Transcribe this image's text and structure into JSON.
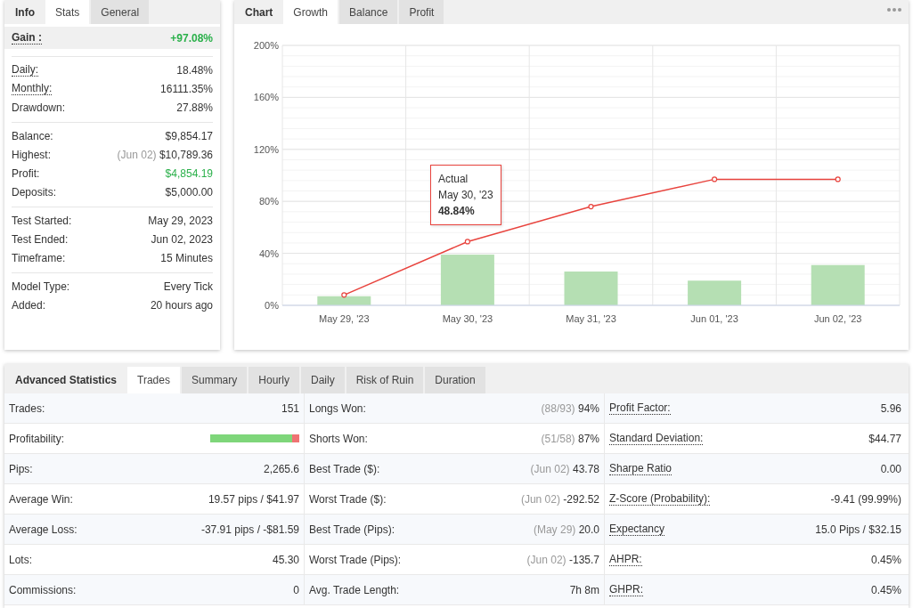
{
  "stats_panel": {
    "title": "Info",
    "tabs": [
      {
        "label": "Stats",
        "selected": true
      },
      {
        "label": "General",
        "selected": false
      }
    ],
    "gain": {
      "label": "Gain :",
      "value": "+97.08%",
      "hint": true,
      "color": "#2ab04a"
    },
    "groups": [
      [
        {
          "label": "Daily:",
          "value": "18.48%",
          "hint": true
        },
        {
          "label": "Monthly:",
          "value": "16111.35%",
          "hint": true
        },
        {
          "label": "Drawdown:",
          "value": "27.88%"
        }
      ],
      [
        {
          "label": "Balance:",
          "value": "$9,854.17"
        },
        {
          "label": "Highest:",
          "note": "(Jun 02)",
          "value": "$10,789.36"
        },
        {
          "label": "Profit:",
          "value": "$4,854.19",
          "color": "#2ab04a"
        },
        {
          "label": "Deposits:",
          "value": "$5,000.00"
        }
      ],
      [
        {
          "label": "Test Started:",
          "value": "May 29, 2023"
        },
        {
          "label": "Test Ended:",
          "value": "Jun 02, 2023"
        },
        {
          "label": "Timeframe:",
          "value": "15 Minutes"
        }
      ],
      [
        {
          "label": "Model Type:",
          "value": "Every Tick"
        },
        {
          "label": "Added:",
          "value": "20 hours ago"
        }
      ]
    ]
  },
  "chart_panel": {
    "title": "Chart",
    "tabs": [
      {
        "label": "Growth",
        "selected": true
      },
      {
        "label": "Balance",
        "selected": false
      },
      {
        "label": "Profit",
        "selected": false
      }
    ],
    "chart_data": {
      "type": "bar",
      "grid": true,
      "categories": [
        "May 29, '23",
        "May 30, '23",
        "May 31, '23",
        "Jun 01, '23",
        "Jun 02, '23"
      ],
      "ylim": [
        0,
        200
      ],
      "yticks": [
        {
          "value": 0,
          "label": "0%"
        },
        {
          "value": 40,
          "label": "40%"
        },
        {
          "value": 80,
          "label": "80%"
        },
        {
          "value": 120,
          "label": "120%"
        },
        {
          "value": 160,
          "label": "160%"
        },
        {
          "value": 200,
          "label": "200%"
        }
      ],
      "series": [
        {
          "type": "bar",
          "color": "#b5dfb3",
          "values": [
            7,
            39,
            26,
            19,
            31
          ]
        },
        {
          "type": "line",
          "name": "Actual",
          "color": "#e8433d",
          "marker": true,
          "values": [
            8,
            49,
            76,
            97,
            97
          ]
        }
      ]
    },
    "tooltip": {
      "date": "May 30, '23",
      "value": "48.84%"
    }
  },
  "advanced": {
    "title": "Advanced Statistics",
    "tabs": [
      {
        "label": "Trades",
        "selected": true
      },
      {
        "label": "Summary",
        "selected": false
      },
      {
        "label": "Hourly",
        "selected": false
      },
      {
        "label": "Daily",
        "selected": false
      },
      {
        "label": "Risk of Ruin",
        "selected": false
      },
      {
        "label": "Duration",
        "selected": false
      }
    ],
    "rows": [
      [
        {
          "kind": "text",
          "label": "Trades:",
          "value": "151"
        },
        {
          "kind": "text",
          "label": "Longs Won:",
          "note": "(88/93)",
          "value": "94%"
        },
        {
          "kind": "text",
          "label": "Profit Factor:",
          "value": "5.96",
          "hint": true
        }
      ],
      [
        {
          "kind": "bar",
          "label": "Profitability:",
          "level": 0.92
        },
        {
          "kind": "text",
          "label": "Shorts Won:",
          "note": "(51/58)",
          "value": "87%"
        },
        {
          "kind": "text",
          "label": "Standard Deviation:",
          "value": "$44.77",
          "hint": true
        }
      ],
      [
        {
          "kind": "text",
          "label": "Pips:",
          "value": "2,265.6"
        },
        {
          "kind": "text",
          "label": "Best Trade ($):",
          "note": "(Jun 02)",
          "value": "43.78"
        },
        {
          "kind": "text",
          "label": "Sharpe Ratio",
          "value": "0.00",
          "hint": true
        }
      ],
      [
        {
          "kind": "text",
          "label": "Average Win:",
          "value": "19.57 pips / $41.97"
        },
        {
          "kind": "text",
          "label": "Worst Trade ($):",
          "note": "(Jun 02)",
          "value": "-292.52"
        },
        {
          "kind": "text",
          "label": "Z-Score (Probability):",
          "value": "-9.41 (99.99%)",
          "hint": true
        }
      ],
      [
        {
          "kind": "text",
          "label": "Average Loss:",
          "value": "-37.91 pips / -$81.59"
        },
        {
          "kind": "text",
          "label": "Best Trade (Pips):",
          "note": "(May 29)",
          "value": "20.0"
        },
        {
          "kind": "text",
          "label": "Expectancy",
          "value": "15.0 Pips / $32.15",
          "hint": true
        }
      ],
      [
        {
          "kind": "text",
          "label": "Lots:",
          "value": "45.30"
        },
        {
          "kind": "text",
          "label": "Worst Trade (Pips):",
          "note": "(Jun 02)",
          "value": "-135.7"
        },
        {
          "kind": "text",
          "label": "AHPR:",
          "value": "0.45%",
          "hint": true
        }
      ],
      [
        {
          "kind": "text",
          "label": "Commissions:",
          "value": "0"
        },
        {
          "kind": "text",
          "label": "Avg. Trade Length:",
          "value": "7h 8m"
        },
        {
          "kind": "text",
          "label": "GHPR:",
          "value": "0.45%",
          "hint": true
        }
      ]
    ]
  }
}
